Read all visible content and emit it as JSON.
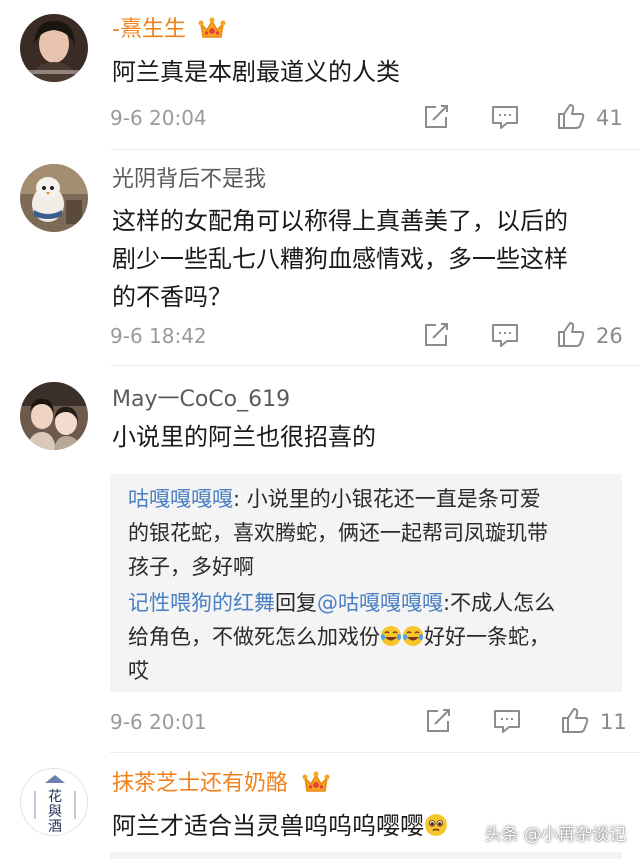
{
  "comments": [
    {
      "username": "-熹生生",
      "text": "阿兰真是本剧最道义的人类",
      "time": "9-6 20:04",
      "likes": "41"
    },
    {
      "username": "光阴背后不是我",
      "text_lines": [
        "这样的女配角可以称得上真善美了，以后的",
        "剧少一些乱七八糟狗血感情戏，多一些这样",
        "的不香吗？"
      ],
      "time": "9-6 18:42",
      "likes": "26"
    },
    {
      "username": "May一CoCo_619",
      "text": "小说里的阿兰也很招喜的",
      "time": "9-6 20:01",
      "likes": "11",
      "replies": [
        {
          "author": "咕嘎嘎嘎嘎",
          "sep": ": ",
          "line1": "小说里的小银花还一直是条可爱",
          "line2": "的银花蛇，喜欢腾蛇，俩还一起帮司凤璇玑带",
          "line3": "孩子，多好啊"
        },
        {
          "author": "记性喂狗的红舞",
          "reply_word": "回复",
          "mention": "@咕嘎嘎嘎嘎",
          "line1_rest": ":不成人怎么",
          "line2_pre": "给角色，不做死怎么加戏份",
          "line2_post": "好好一条蛇，",
          "line3": "哎"
        }
      ]
    },
    {
      "username": "抹茶芝士还有奶酪",
      "text": "阿兰才适合当灵兽呜呜呜嘤嘤"
    }
  ],
  "watermark": "头条 @小苒杂谈记",
  "icons": {
    "crown": "crown-icon",
    "repost": "repost-icon",
    "comment": "comment-icon",
    "like": "thumbs-up-icon"
  },
  "colors": {
    "vip_name": "#f0821e",
    "link": "#4a7fc1",
    "meta": "#9a9a9a"
  }
}
